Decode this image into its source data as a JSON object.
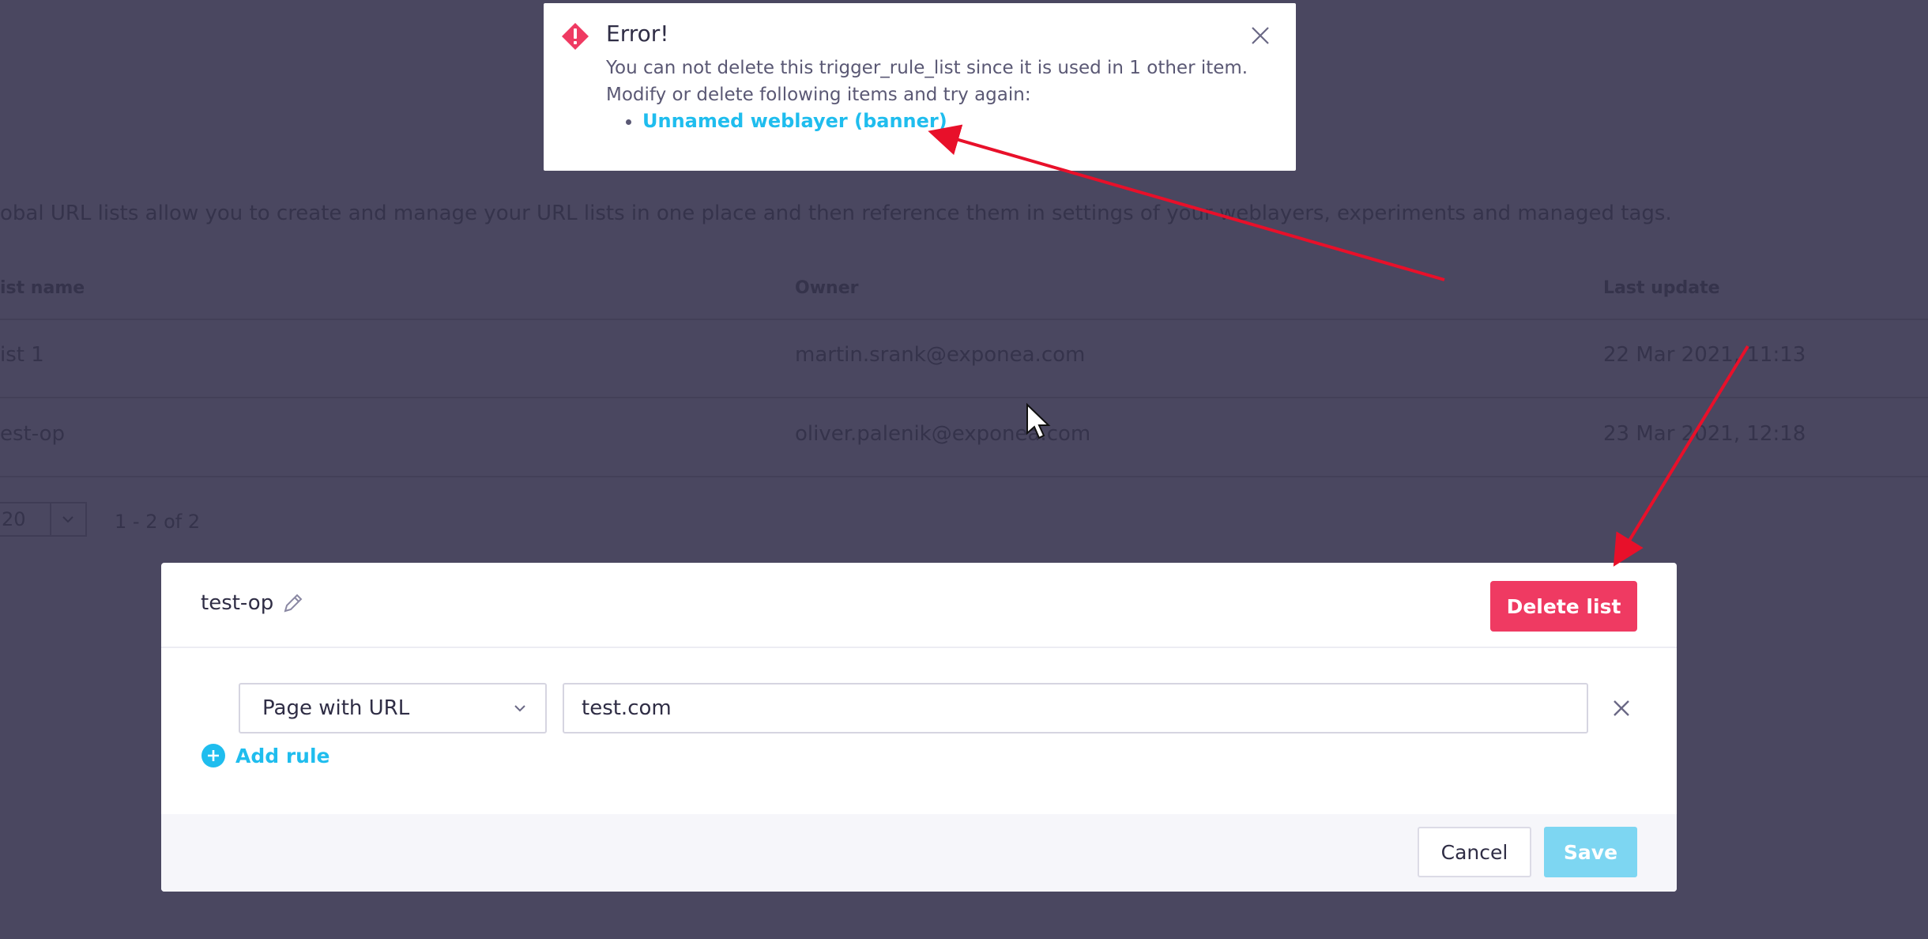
{
  "background": {
    "description": "obal URL lists allow you to create and manage your URL lists in one place and then reference them in settings of your weblayers, experiments and managed tags.",
    "table": {
      "headers": [
        "ist name",
        "Owner",
        "Last update"
      ],
      "rows": [
        [
          "ist 1",
          "martin.srank@exponea.com",
          "22 Mar 2021, 11:13"
        ],
        [
          "est-op",
          "oliver.palenik@exponea.com",
          "23 Mar 2021, 12:18"
        ]
      ]
    },
    "pagination": {
      "per_page": "20",
      "range": "1 - 2 of 2"
    }
  },
  "toast": {
    "title": "Error!",
    "message_line1": "You can not delete this trigger_rule_list since it is used in 1 other item.",
    "message_line2": "Modify or delete following items and try again:",
    "items": [
      "Unnamed weblayer (banner)"
    ],
    "icon": "warning-diamond-icon",
    "accent": "#ef3a62",
    "link_color": "#1fbdee"
  },
  "modal": {
    "list_name": "test-op",
    "delete_label": "Delete list",
    "rule": {
      "type": "Page with URL",
      "value": "test.com"
    },
    "add_rule_label": "Add rule",
    "cancel_label": "Cancel",
    "save_label": "Save",
    "colors": {
      "danger": "#ef3a62",
      "primary_disabled": "#7dd6f2",
      "link": "#1fbdee"
    }
  }
}
